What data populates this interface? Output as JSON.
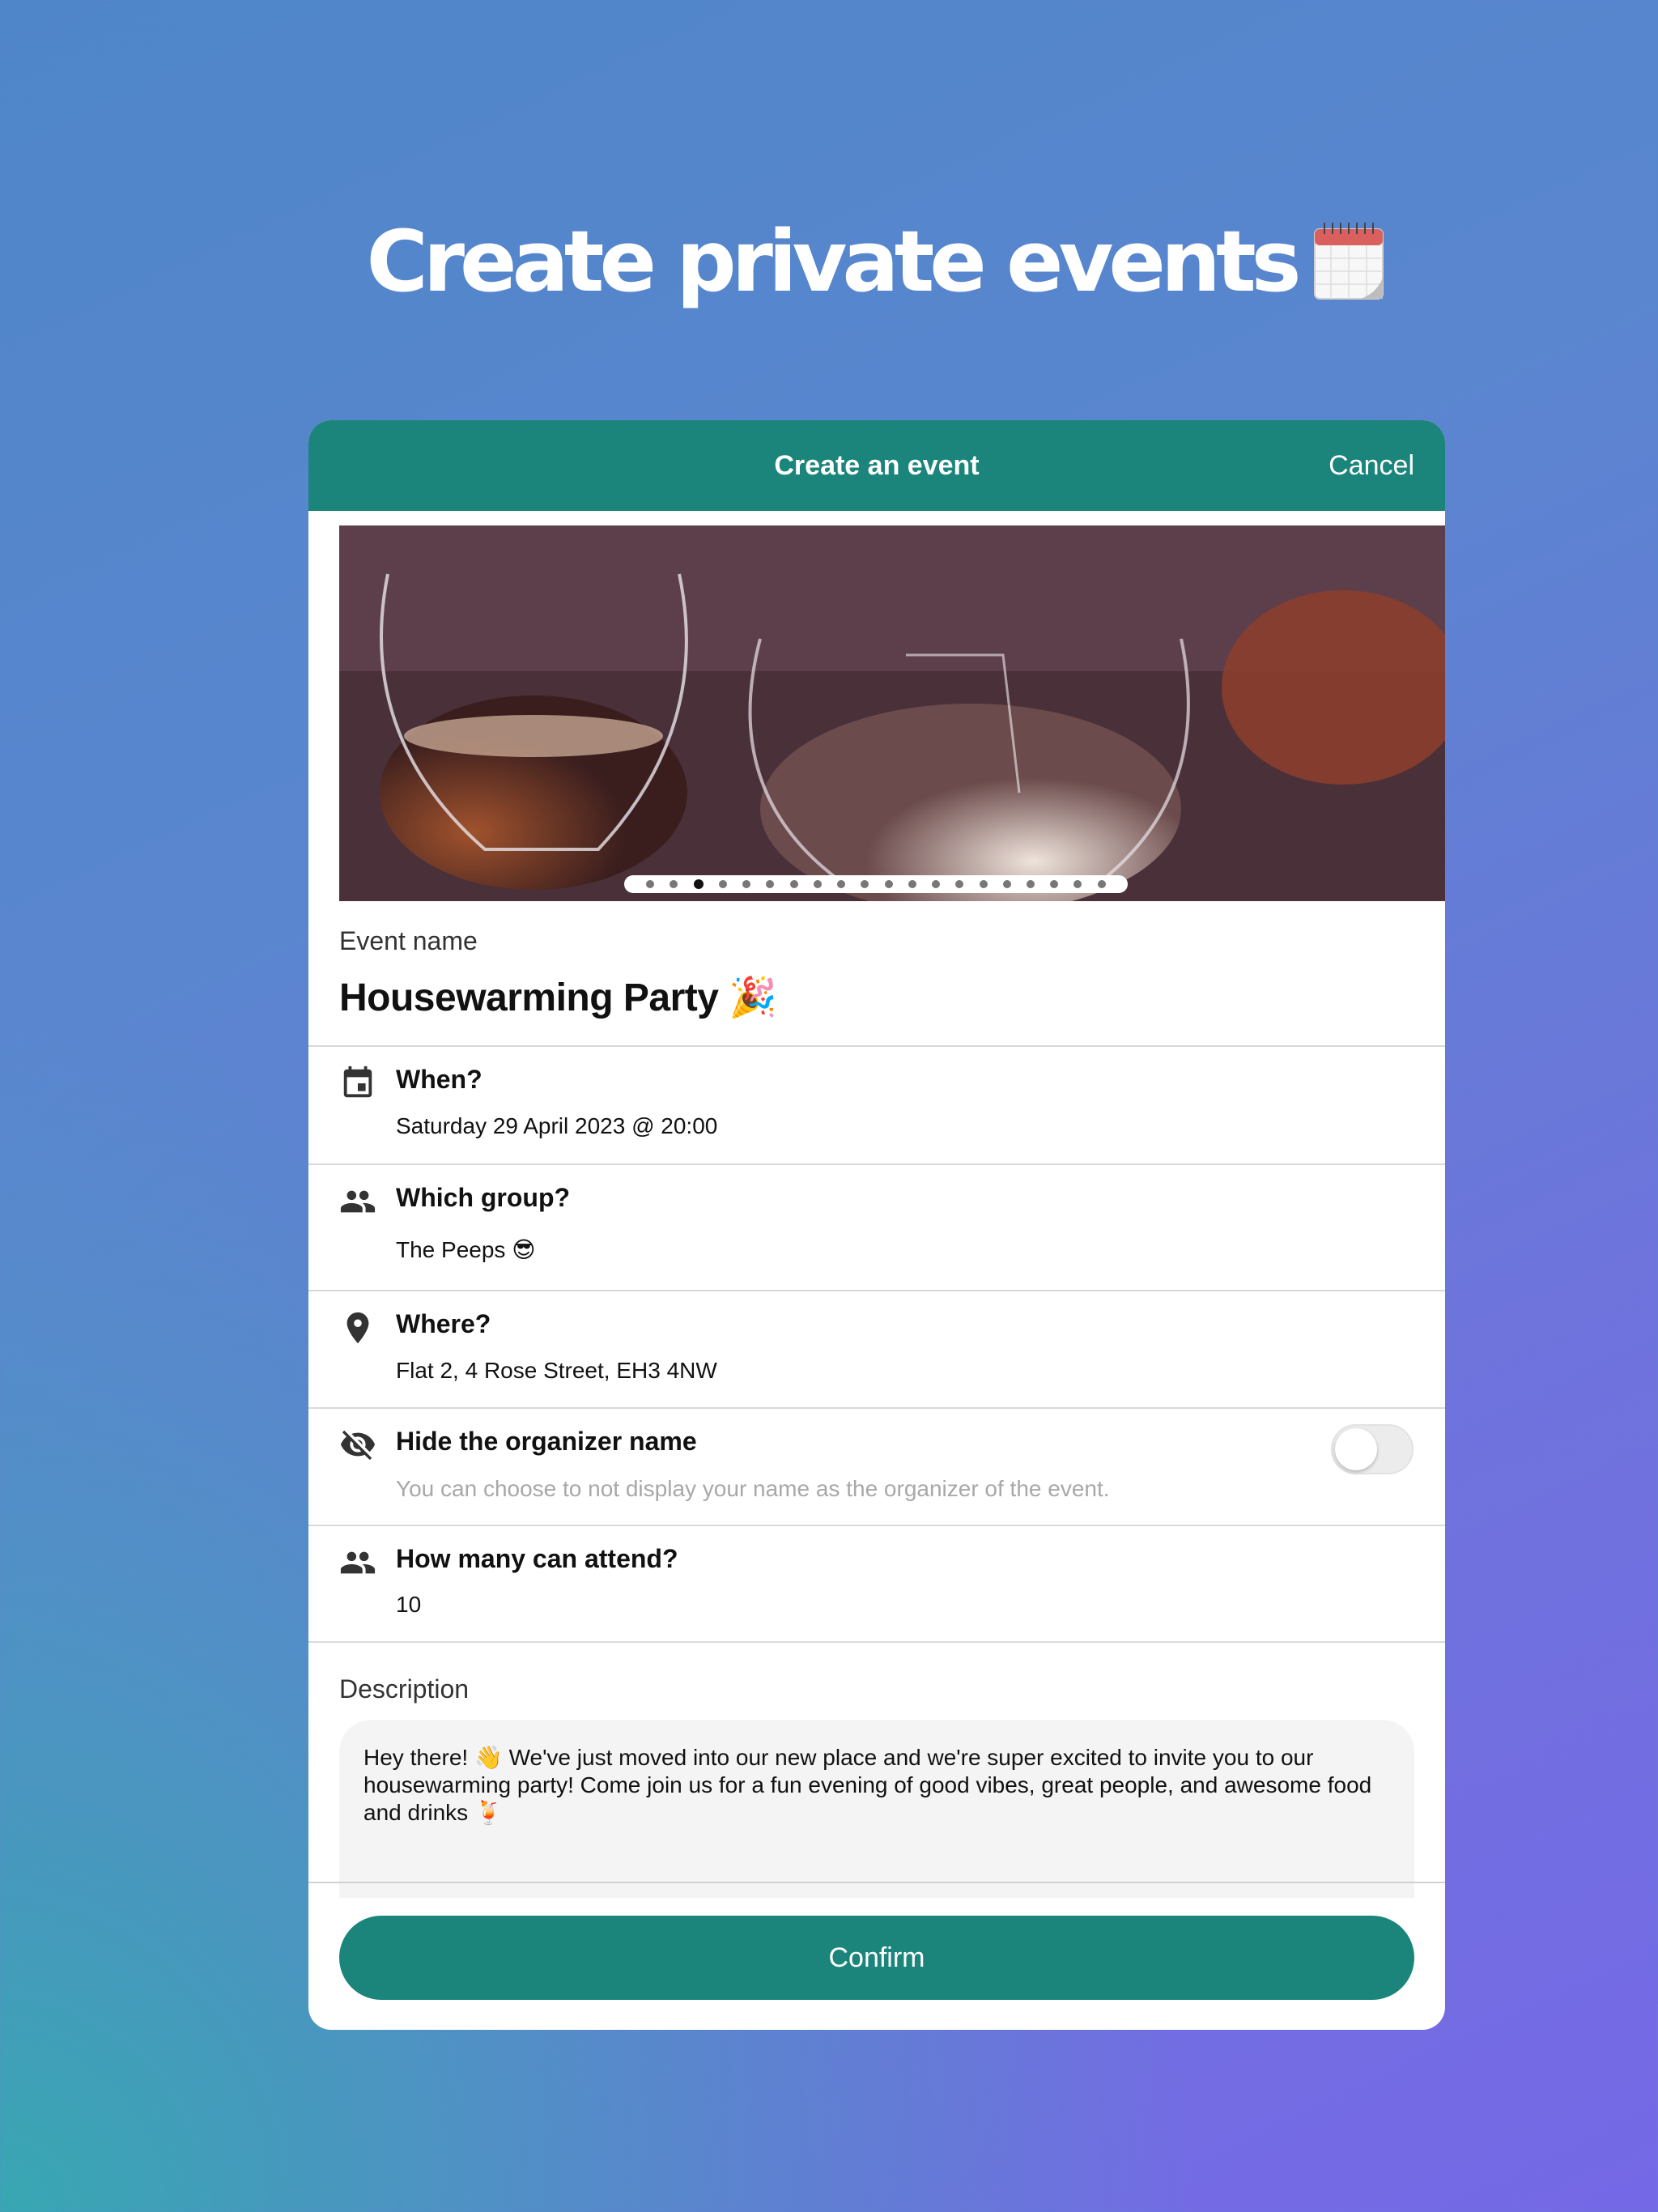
{
  "headline": {
    "text": "Create private events",
    "icon": "calendar-emoji"
  },
  "header": {
    "title": "Create an event",
    "cancel_label": "Cancel"
  },
  "carousel": {
    "total": 20,
    "active_index": 2
  },
  "event_name": {
    "label": "Event name",
    "value": "Housewarming Party 🎉"
  },
  "when": {
    "icon": "calendar-icon",
    "title": "When?",
    "value": "Saturday 29 April 2023 @ 20:00"
  },
  "group": {
    "icon": "people-icon",
    "title": "Which group?",
    "value": "The Peeps 😎"
  },
  "where": {
    "icon": "location-pin-icon",
    "title": "Where?",
    "value": "Flat 2, 4 Rose Street, EH3 4NW"
  },
  "hide_organizer": {
    "icon": "eye-off-icon",
    "title": "Hide the organizer name",
    "hint": "You can choose to not display your name as the organizer of the event.",
    "enabled": false
  },
  "capacity": {
    "icon": "people-icon",
    "title": "How many can attend?",
    "value": "10"
  },
  "description": {
    "label": "Description",
    "value": "Hey there! 👋 We've just moved into our new place and we're super excited to invite you to our housewarming party! Come join us for a fun evening of good vibes, great people, and awesome food and drinks 🍹"
  },
  "confirm_label": "Confirm",
  "colors": {
    "primary": "#1c857b",
    "background_start": "#38a7b2",
    "background_end": "#7568e6"
  }
}
